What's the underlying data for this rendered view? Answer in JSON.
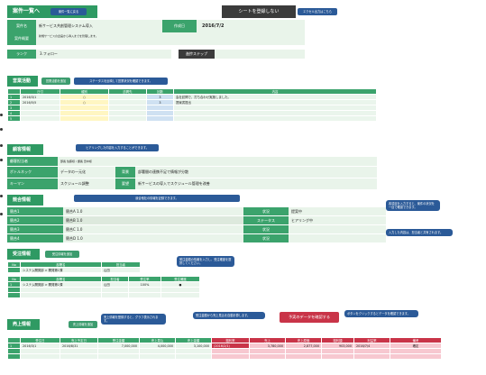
{
  "header": {
    "title": "案件一覧へ",
    "small_button": "案件一覧に戻る",
    "center_title": "シートを登録しない",
    "right_button": "エクセル出力はこちら"
  },
  "project": {
    "name_label": "案件名",
    "name_value": "新サービス共創管理システム導入",
    "date_label": "作成日",
    "date_value": "2016/7/2",
    "summary_label": "案件概要",
    "summary_value": "新規サービスの企画から導入までを管理します。",
    "rank_label": "ランク",
    "rank_value": "3.フォロー",
    "status_label": "進捗ステップ",
    "status_value": ""
  },
  "activity": {
    "title": "営業活動",
    "btn1": "営業活動を追加",
    "btn2": "ステータスを反映して営業状況を確認できます。",
    "headers": [
      "日付",
      "種別",
      "訪問先",
      "回数",
      "内容"
    ],
    "rows": [
      {
        "no": "1",
        "date": "2016/3/1",
        "type": "○",
        "count": "3",
        "content": "会社訪問で、打ち合わせ実施しました。"
      },
      {
        "no": "2",
        "date": "2016/5/5",
        "type": "○",
        "count": "3",
        "content": "提案書提出"
      },
      {
        "no": "3",
        "date": "",
        "type": "",
        "count": "",
        "content": ""
      },
      {
        "no": "4",
        "date": "",
        "type": "",
        "count": "",
        "content": ""
      },
      {
        "no": "5",
        "date": "",
        "type": "",
        "count": "",
        "content": ""
      }
    ]
  },
  "hearing": {
    "title": "顧客情報",
    "tip": "ヒアリングした内容を入力することができます。",
    "rows": [
      {
        "label": "顧客担当者",
        "value": "部長 佐藤様 / 課長 田中様"
      },
      {
        "label": "ボトルネック",
        "value": "データの一元化",
        "sub_label": "背景",
        "sub_value": "部署間の連携不足で情報が分散"
      },
      {
        "label": "キーマン",
        "value": "スケジュール調整",
        "sub_label": "要望",
        "sub_value": "新サービスの導入でスケジュール管理を改善"
      }
    ]
  },
  "competitor": {
    "title": "競合情報",
    "tip": "競合他社の情報を記録できます。",
    "rows": [
      {
        "label": "競合1",
        "value": "競合A 1.0",
        "right_label": "状況",
        "right_value": "提案中"
      },
      {
        "label": "競合2",
        "value": "競合B 1.0",
        "right_label": "ステータス",
        "right_value": "ヒアリング中"
      },
      {
        "label": "競合3",
        "value": "競合C 1.0",
        "right_label": "状況",
        "right_value": ""
      },
      {
        "label": "競合4",
        "value": "競合D 1.0",
        "right_label": "状況",
        "right_value": ""
      }
    ]
  },
  "contract": {
    "title": "受注情報",
    "btn": "受注情報を追加",
    "headers1": [
      "No",
      "部署名",
      "担当者"
    ],
    "row1": {
      "no": "",
      "dept": "システム開発部 > 開発第1課",
      "person": "山田"
    },
    "headers2": [
      "No",
      "部署名",
      "担当者",
      "受注率",
      "受注確度"
    ],
    "row2": {
      "no": "1",
      "dept": "システム開発部 > 開発第1課",
      "person": "山田",
      "rate": "100%",
      "sure": "●"
    },
    "tip": "受注金額の情報を入力し、受注確度を選択してください。"
  },
  "revenue": {
    "title": "売上情報",
    "btn": "売上情報を追加",
    "tip1": "売上情報を登録すると、グラフ表示されます。",
    "tip2": "受注金額から売上見込を自動計算します。",
    "highlight_tip": "予実のデータを確認する",
    "tip3": "ボタンをクリックするとデータを確認できます。",
    "headers": [
      "受注日",
      "売上予定日",
      "受注金額",
      "売上見込",
      "売上金額",
      "粗利率",
      "売上",
      "売上原価",
      "粗利額",
      "利益率",
      "備考"
    ],
    "row": {
      "no": "1",
      "c1": "2016/3/1",
      "c2": "2016/8/31",
      "c3": "7,000,000",
      "c4": "4,000,000",
      "c5": "3,100,000",
      "c6": "(2016/2/1)",
      "c7": "3,780,000",
      "c8": "2,877,000",
      "c9": "903,000",
      "c10": "2016/7/4",
      "c11": "確定"
    }
  },
  "side_tips": {
    "tip1": "各項目を入力すると、案件の状況を一目で確認できます。",
    "tip2": "入力した内容は、担当者と共有されます。"
  }
}
